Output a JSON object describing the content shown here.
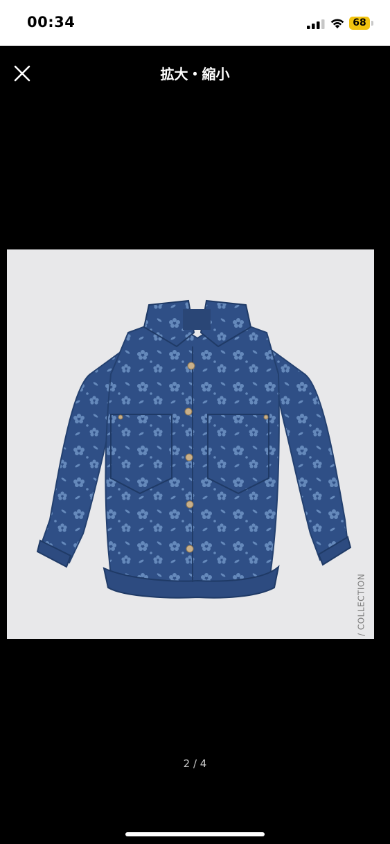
{
  "status_bar": {
    "time": "00:34",
    "battery_percent": "68"
  },
  "header": {
    "title": "拡大・縮小",
    "close_icon": "close-icon"
  },
  "image": {
    "alt_overlay_text": "/ COLLECTION",
    "subject": "floral denim shirt jacket"
  },
  "pager": {
    "text": "2 / 4"
  },
  "colors": {
    "background": "#000000",
    "photo_bg": "#e8e8ea",
    "battery": "#f2c30f",
    "denim": "#2f4f86"
  }
}
